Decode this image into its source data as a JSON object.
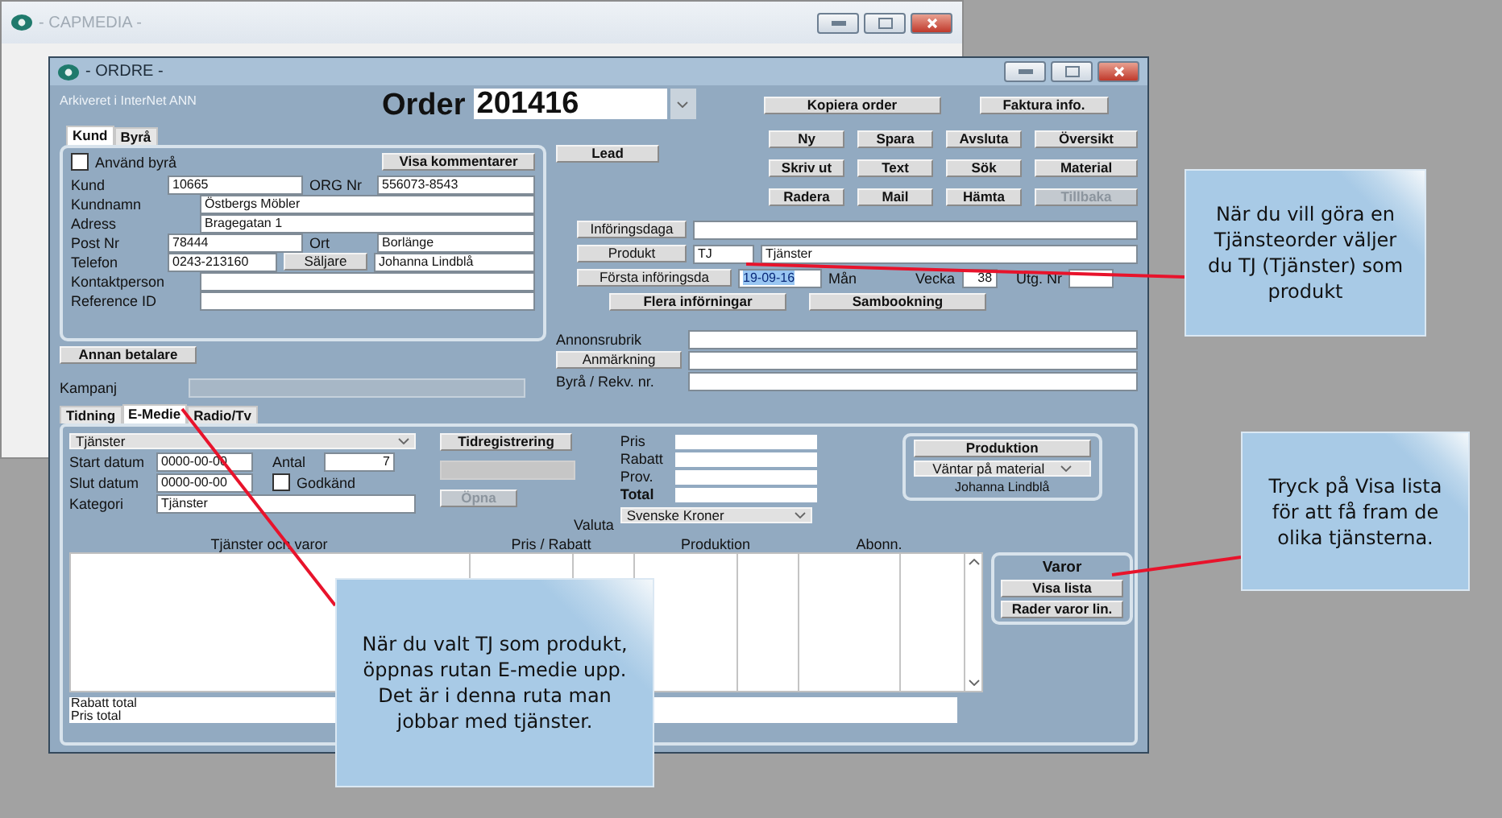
{
  "back_window": {
    "title": "- CAPMEDIA -"
  },
  "window": {
    "title": "- ORDRE -",
    "archive_note": "Arkiveret i InterNet ANN",
    "order_label": "Order",
    "order_number": "201416"
  },
  "top_buttons": [
    "Kopiera order",
    "Faktura info."
  ],
  "customer_tabs": [
    {
      "label": "Kund",
      "selected": true
    },
    {
      "label": "Byrå",
      "selected": false
    }
  ],
  "use_agency": {
    "label": "Använd byrå",
    "checked": false
  },
  "show_comments_button": "Visa kommentarer",
  "customer_rows": [
    {
      "kind": "pair",
      "label": "Kund",
      "value": "10665",
      "extra_label": "ORG Nr",
      "extra_value": "556073-8543"
    },
    {
      "kind": "single",
      "label": "Kundnamn",
      "value": "Östbergs Möbler"
    },
    {
      "kind": "single",
      "label": "Adress",
      "value": "Bragegatan 1"
    },
    {
      "kind": "pair",
      "label": "Post Nr",
      "value": "78444",
      "extra_label": "Ort",
      "extra_value": "Borlänge"
    },
    {
      "kind": "pair_button",
      "label": "Telefon",
      "value": "0243-213160",
      "extra_label": "Säljare",
      "extra_value": "Johanna Lindblå"
    },
    {
      "kind": "single",
      "label": "Kontaktperson"
    },
    {
      "kind": "single",
      "label": "Reference ID"
    }
  ],
  "other_payer_button": "Annan betalare",
  "campaign": {
    "label": "Kampanj"
  },
  "lead_button": "Lead",
  "action_buttons": [
    {
      "label": "Ny",
      "disabled": false
    },
    {
      "label": "Spara",
      "disabled": false
    },
    {
      "label": "Avsluta",
      "disabled": false
    },
    {
      "label": "Översikt",
      "disabled": false
    },
    {
      "label": "Skriv ut",
      "disabled": false
    },
    {
      "label": "Text",
      "disabled": false
    },
    {
      "label": "Sök",
      "disabled": false
    },
    {
      "label": "Material",
      "disabled": false
    },
    {
      "label": "Radera",
      "disabled": false
    },
    {
      "label": "Mail",
      "disabled": false
    },
    {
      "label": "Hämta",
      "disabled": false
    },
    {
      "label": "Tillbaka",
      "disabled": true
    }
  ],
  "insertion": {
    "dates_button": "Införingsdaga",
    "product_button": "Produkt",
    "product_code": "TJ",
    "product_name": "Tjänster",
    "first_date_button": "Första införingsda",
    "first_date": {
      "value": "19-09-16",
      "highlighted": true
    },
    "weekday": "Mån",
    "week_label": "Vecka",
    "week": "38",
    "issue_label": "Utg. Nr",
    "more_button": "Flera införningar",
    "cobooking_button": "Sambookning"
  },
  "ad_rows": [
    {
      "kind": "text",
      "label": "Annonsrubrik"
    },
    {
      "kind": "button",
      "label": "Anmärkning"
    },
    {
      "kind": "text",
      "label": "Byrå / Rekv. nr."
    }
  ],
  "media_tabs": [
    {
      "label": "Tidning",
      "selected": false
    },
    {
      "label": "E-Medie",
      "selected": true
    },
    {
      "label": "Radio/Tv",
      "selected": false
    }
  ],
  "emedia": {
    "service": "Tjänster",
    "start_label": "Start datum",
    "start": "0000-00-00",
    "end_label": "Slut datum",
    "end": "0000-00-00",
    "quantity_label": "Antal",
    "quantity": "7",
    "approved": {
      "label": "Godkänd",
      "checked": false
    },
    "category_label": "Kategori",
    "category": "Tjänster",
    "time_button": "Tidregistrering",
    "open_button": "Öpna",
    "currency_label": "Valuta",
    "currency": "Svenske Kroner",
    "price_rows": [
      {
        "label": "Pris",
        "bold": false
      },
      {
        "label": "Rabatt",
        "bold": false
      },
      {
        "label": "Prov.",
        "bold": false
      },
      {
        "label": "Total",
        "bold": true
      }
    ],
    "production": {
      "button": "Produktion",
      "status": "Väntar på material",
      "person": "Johanna Lindblå"
    },
    "columns": [
      "Tjänster och varor",
      "Pris / Rabatt",
      "Produktion",
      "Abonn."
    ],
    "goods": {
      "title": "Varor",
      "buttons": [
        "Visa lista",
        "Rader varor lin."
      ]
    },
    "totals": [
      "Rabatt total",
      "Pris total"
    ]
  },
  "callouts": [
    {
      "text": "När du vill göra en Tjänsteorder väljer du TJ (Tjänster) som produkt"
    },
    {
      "text": "Tryck på Visa lista för att få fram de olika tjänsterna."
    },
    {
      "text": "När du valt TJ som produkt, öppnas rutan E-medie upp. Det är i denna ruta man jobbar med tjänster."
    }
  ]
}
